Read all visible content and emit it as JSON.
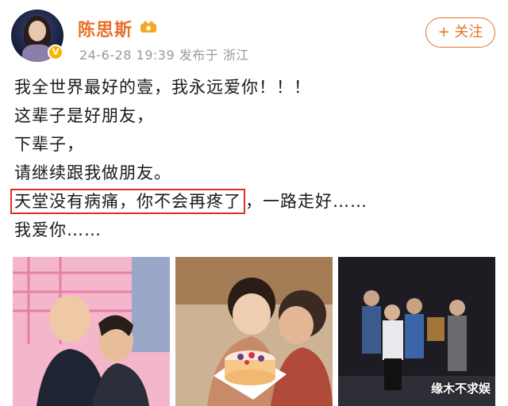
{
  "author": {
    "name": "陈思斯",
    "meta": "24-6-28 19:39  发布于 浙江"
  },
  "follow": {
    "label": "+ 关注"
  },
  "post_lines": [
    "我全世界最好的壹，我永远爱你！！！",
    "这辈子是好朋友，",
    "下辈子，",
    "请继续跟我做朋友。",
    "天堂没有病痛，你不会再疼了",
    "，一路走好……",
    "我爱你……"
  ],
  "watermark": "缘木不求娱",
  "colors": {
    "accent": "#e8702a",
    "highlight_border": "#d9302c"
  }
}
